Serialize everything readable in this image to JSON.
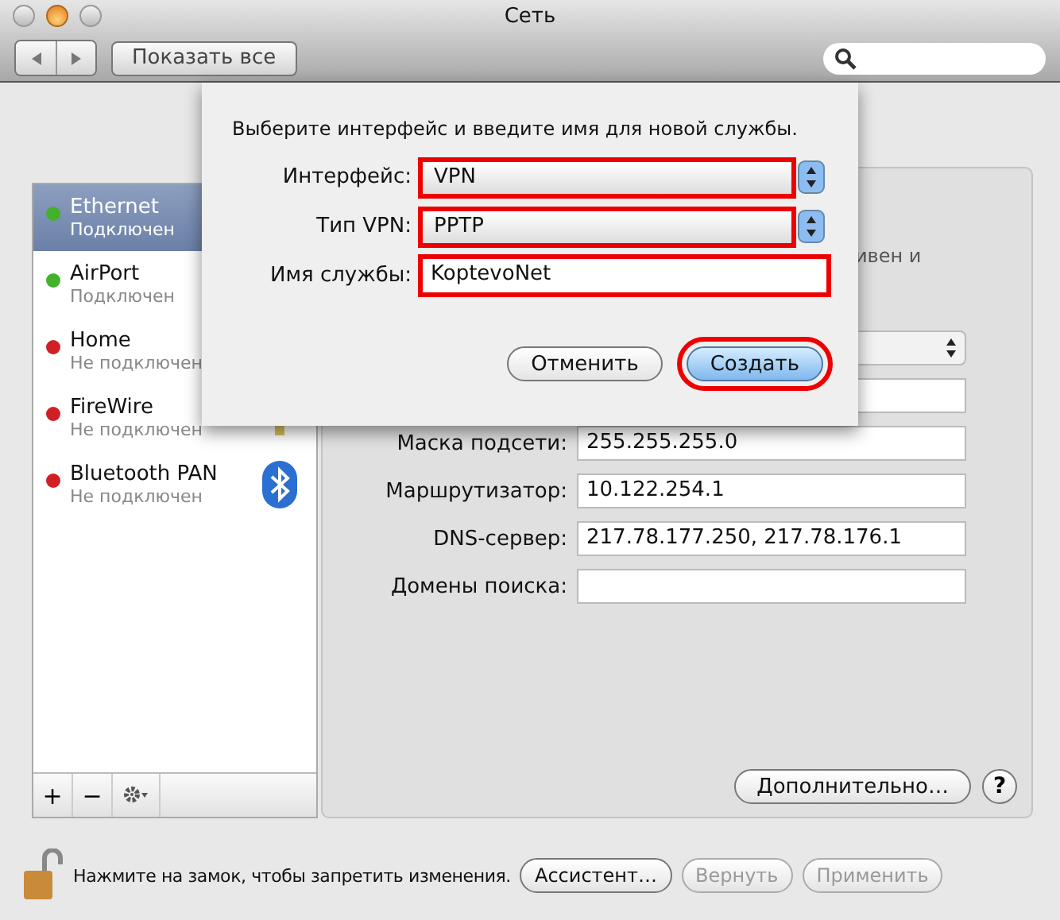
{
  "window": {
    "title": "Сеть"
  },
  "toolbar": {
    "show_all": "Показать все"
  },
  "sidebar": {
    "items": [
      {
        "name": "Ethernet",
        "status": "Подключен",
        "color": "#44b02c",
        "selected": true
      },
      {
        "name": "AirPort",
        "status": "Подключен",
        "color": "#44b02c",
        "selected": false
      },
      {
        "name": "Home",
        "status": "Не подключен",
        "color": "#d21f25",
        "selected": false
      },
      {
        "name": "FireWire",
        "status": "Не подключен",
        "color": "#d21f25",
        "selected": false
      },
      {
        "name": "Bluetooth PAN",
        "status": "Не подключен",
        "color": "#d21f25",
        "selected": false
      }
    ],
    "buttons": [
      "+",
      "−"
    ]
  },
  "panel": {
    "status_fragment": "ивен и",
    "fields": [
      {
        "kind": "popup"
      },
      {
        "kind": "text"
      },
      {
        "kind": "text",
        "label": "Маска подсети:",
        "value": "255.255.255.0"
      },
      {
        "kind": "text",
        "label": "Маршрутизатор:",
        "value": "10.122.254.1"
      },
      {
        "kind": "text",
        "label": "DNS-сервер:",
        "value": "217.78.177.250, 217.78.176.1"
      },
      {
        "kind": "text",
        "label": "Домены поиска:"
      }
    ],
    "advanced": "Дополнительно…",
    "help": "?"
  },
  "footer": {
    "lock_text": "Нажмите на замок, чтобы запретить изменения.",
    "buttons": [
      {
        "label": "Ассистент…",
        "disabled": false
      },
      {
        "label": "Вернуть",
        "disabled": true
      },
      {
        "label": "Применить",
        "disabled": true
      }
    ]
  },
  "sheet": {
    "prompt": "Выберите интерфейс и введите имя для новой службы.",
    "rows": [
      {
        "kind": "popup",
        "label": "Интерфейс:",
        "value": "VPN",
        "highlighted": true
      },
      {
        "kind": "popup",
        "label": "Тип VPN:",
        "value": "PPTP",
        "highlighted": true
      },
      {
        "kind": "text",
        "label": "Имя службы:",
        "value": "KoptevoNet",
        "highlighted": true
      }
    ],
    "buttons": [
      {
        "label": "Отменить",
        "default": false,
        "highlighted": false
      },
      {
        "label": "Создать",
        "default": true,
        "highlighted": true
      }
    ]
  }
}
